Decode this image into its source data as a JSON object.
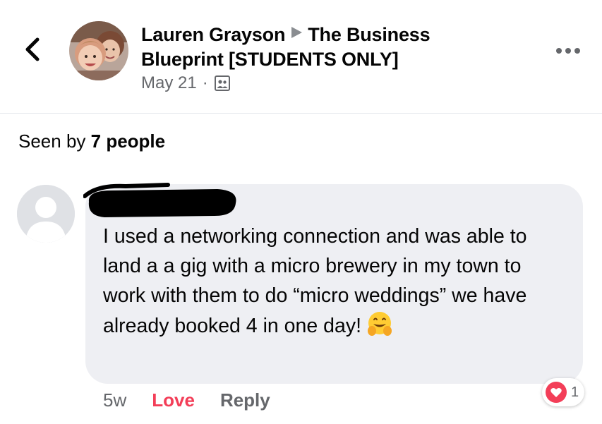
{
  "header": {
    "author": "Lauren Grayson",
    "group": "The Business Blueprint [STUDENTS ONLY]",
    "date": "May 21",
    "separator": "·",
    "privacy_icon": "group-members-icon",
    "back_icon": "chevron-left-icon",
    "more_icon": "more-dots-icon"
  },
  "seen_by": {
    "prefix": "Seen by",
    "count_text": "7 people"
  },
  "comment": {
    "text": "I used a networking connection and was able to land a a gig with a micro brewery in my town to work with them to do “micro weddings” we have already booked 4 in one day!",
    "emoji": "hugging-face-icon",
    "time": "5w",
    "love_label": "Love",
    "reply_label": "Reply",
    "reaction_icon": "heart-reaction-icon",
    "reaction_count": "1"
  },
  "colors": {
    "love": "#f33e58",
    "muted": "#65676b",
    "bubble": "#eeeff3"
  }
}
